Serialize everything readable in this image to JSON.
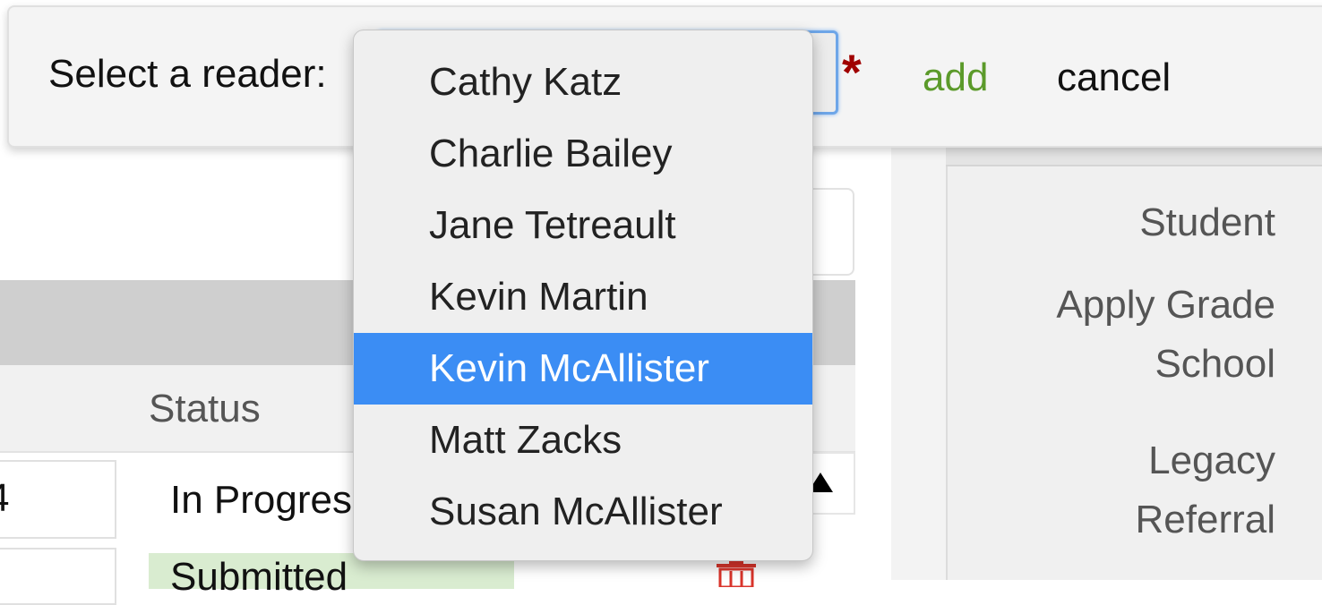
{
  "modal": {
    "label": "Select a reader:",
    "required_mark": "*",
    "add_label": "add",
    "cancel_label": "cancel"
  },
  "dropdown": {
    "options": [
      "Cathy Katz",
      "Charlie Bailey",
      "Jane Tetreault",
      "Kevin Martin",
      "Kevin McAllister",
      "Matt Zacks",
      "Susan McAllister"
    ],
    "highlighted_option": "Kevin McAllister"
  },
  "background": {
    "table": {
      "status_header": "Status",
      "rows": [
        {
          "id_fragment": "4",
          "status": "In Progres"
        },
        {
          "id_fragment": "",
          "status": "Submitted"
        }
      ]
    },
    "right_panel": {
      "labels": [
        "Student",
        "Apply Grade School",
        "Legacy Referral"
      ]
    }
  },
  "colors": {
    "highlight": "#3b8df4",
    "add_link": "#5b9a2a",
    "required": "#a00000",
    "focus_border": "#6ea6e8",
    "submitted_row": "#d9ecd0",
    "trash_icon": "#d9342b"
  }
}
